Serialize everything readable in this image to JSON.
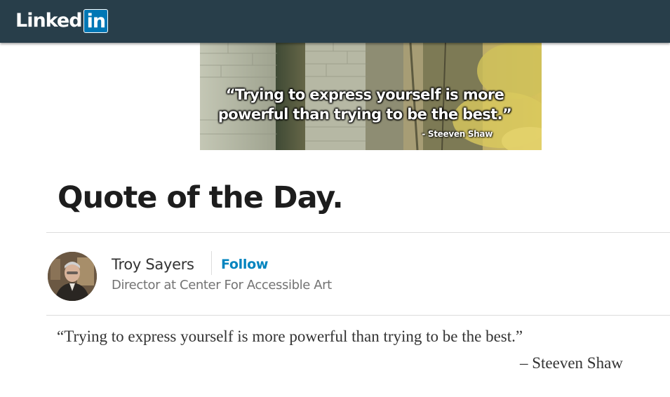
{
  "header": {
    "logo_text": "Linked",
    "logo_box_text": "in",
    "background_color": "#283e4a",
    "brand_color": "#0077b5"
  },
  "banner": {
    "quote_line1": "“Trying to express yourself is more",
    "quote_line2": "powerful than trying to be the best.”",
    "author": "- Steeven Shaw"
  },
  "article": {
    "title": "Quote of the Day.",
    "author_name": "Troy Sayers",
    "follow_label": "Follow",
    "author_headline": "Director at Center For Accessible Art",
    "body_quote": "“Trying to express yourself is more powerful than trying to be the best.”",
    "body_author": "– Steeven Shaw",
    "follow_color": "#0084bf"
  }
}
